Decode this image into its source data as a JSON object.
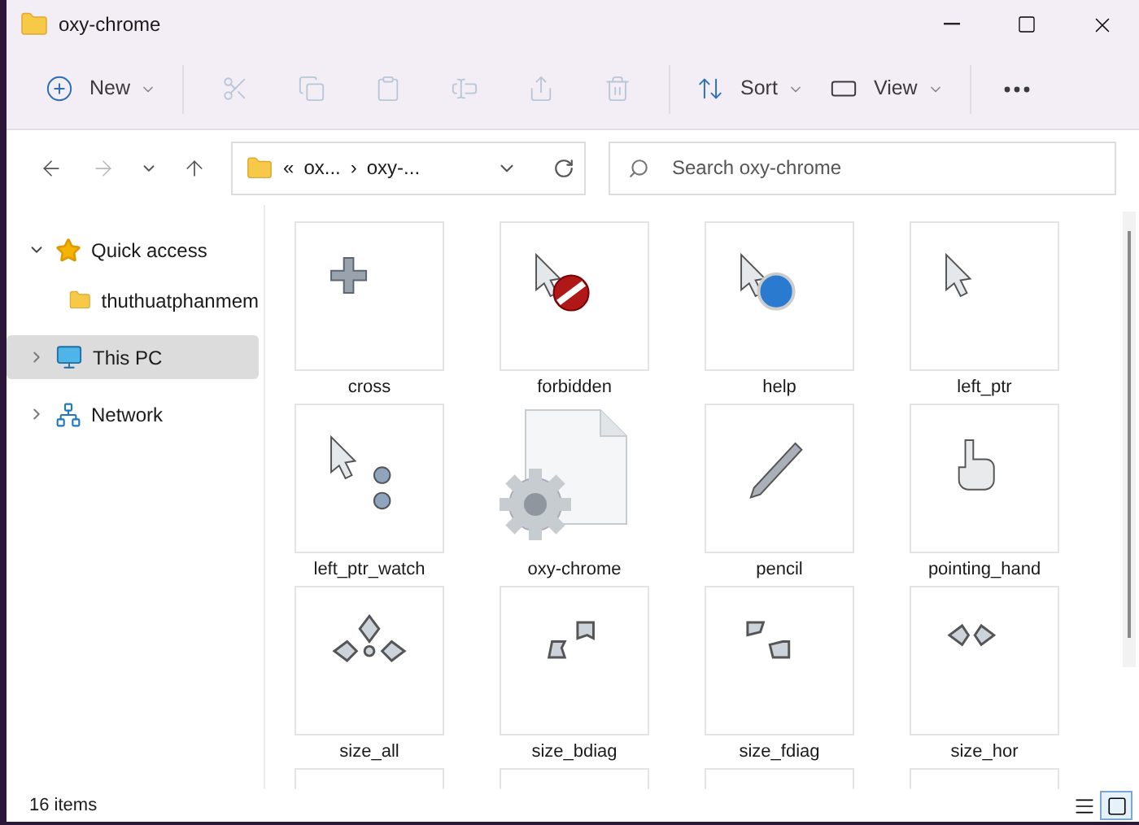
{
  "window": {
    "title": "oxy-chrome"
  },
  "toolbar": [
    {
      "kind": "menu",
      "label": "New",
      "disabled": false
    },
    {
      "kind": "icon",
      "disabled": true
    },
    {
      "kind": "icon",
      "disabled": true
    },
    {
      "kind": "icon",
      "disabled": true
    },
    {
      "kind": "icon",
      "disabled": true
    },
    {
      "kind": "icon",
      "disabled": true
    },
    {
      "kind": "icon",
      "disabled": true
    },
    {
      "kind": "menu",
      "label": "Sort",
      "disabled": false
    },
    {
      "kind": "menu",
      "label": "View",
      "disabled": false
    },
    {
      "kind": "more",
      "disabled": false
    }
  ],
  "navigation": {
    "back_disabled": false,
    "forward_disabled": true
  },
  "address": {
    "segments": [
      "«",
      "ox...",
      "›",
      "oxy-..."
    ]
  },
  "search": {
    "placeholder": "Search oxy-chrome"
  },
  "sidebar": {
    "items": [
      {
        "label": "Quick access",
        "expanded": true,
        "selected": false,
        "children": [
          {
            "label": "thuthuatphanmem",
            "selected": false
          }
        ]
      },
      {
        "label": "This PC",
        "expanded": false,
        "selected": true
      },
      {
        "label": "Network",
        "expanded": false,
        "selected": false
      }
    ]
  },
  "files": [
    {
      "name": "cross",
      "kind": "thumbnail"
    },
    {
      "name": "forbidden",
      "kind": "thumbnail"
    },
    {
      "name": "help",
      "kind": "thumbnail"
    },
    {
      "name": "left_ptr",
      "kind": "thumbnail"
    },
    {
      "name": "left_ptr_watch",
      "kind": "thumbnail"
    },
    {
      "name": "oxy-chrome",
      "kind": "settings_file"
    },
    {
      "name": "pencil",
      "kind": "thumbnail"
    },
    {
      "name": "pointing_hand",
      "kind": "thumbnail"
    },
    {
      "name": "size_all",
      "kind": "thumbnail"
    },
    {
      "name": "size_bdiag",
      "kind": "thumbnail"
    },
    {
      "name": "size_fdiag",
      "kind": "thumbnail"
    },
    {
      "name": "size_hor",
      "kind": "thumbnail"
    },
    {
      "kind": "thumbnail"
    },
    {
      "kind": "thumbnail"
    },
    {
      "kind": "thumbnail"
    },
    {
      "kind": "thumbnail"
    }
  ],
  "status_bar": {
    "count": "16 items",
    "views": [
      {
        "kind": "details",
        "selected": false
      },
      {
        "kind": "large_icons",
        "selected": true
      }
    ]
  }
}
